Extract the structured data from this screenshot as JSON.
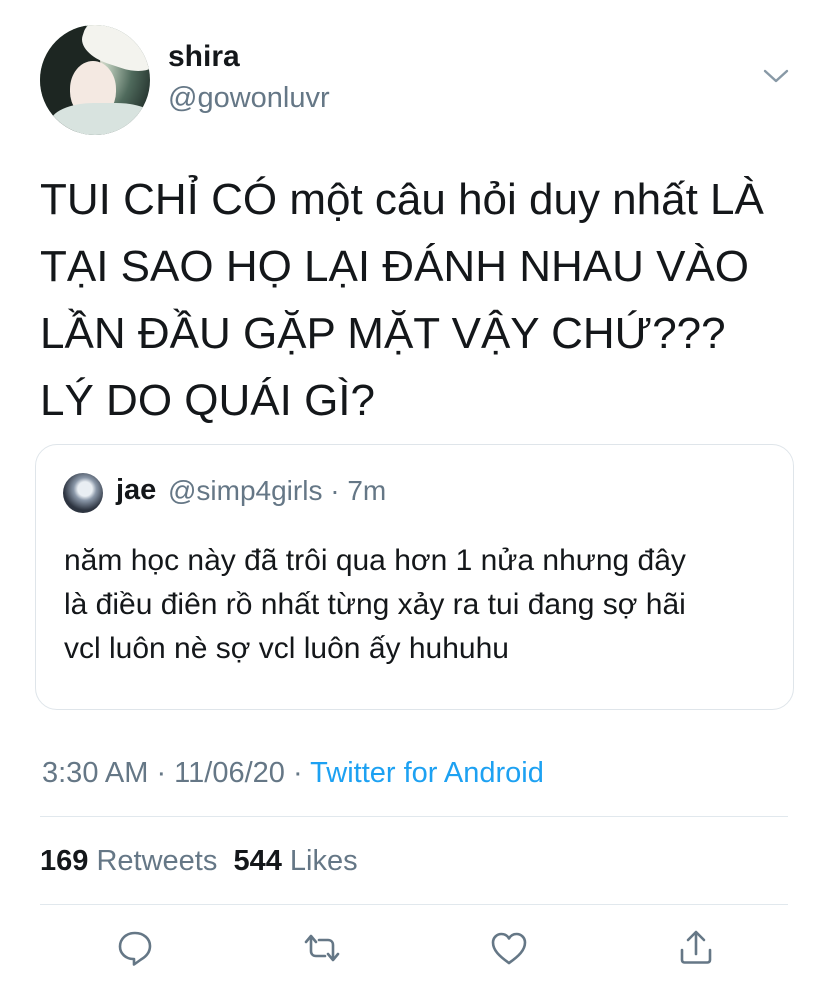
{
  "tweet": {
    "author": {
      "display_name": "shira",
      "handle": "@gowonluvr"
    },
    "text": "TUI CHỈ CÓ một câu hỏi duy nhất LÀ\nTẠI SAO HỌ LẠI ĐÁNH NHAU VÀO\nLẦN ĐẦU GẶP MẶT VẬY CHỨ???\nLÝ DO QUÁI GÌ?",
    "time": "3:30 AM · 11/06/20 · ",
    "source": "Twitter for Android"
  },
  "quoted": {
    "display_name": "jae",
    "meta": "@simp4girls · 7m",
    "text": "năm học này đã trôi qua hơn 1 nửa nhưng đây\nlà điều điên rồ nhất từng xảy ra tui đang sợ hãi\nvcl luôn nè sợ vcl luôn ấy huhuhu"
  },
  "stats": {
    "retweets_count": "169",
    "retweets_label": "Retweets",
    "likes_count": "544",
    "likes_label": "Likes"
  },
  "icons": {
    "menu": "chevron-down-icon",
    "reply": "reply-icon",
    "retweet": "retweet-icon",
    "like": "heart-icon",
    "share": "share-icon"
  },
  "colors": {
    "accent": "#1da1f2",
    "secondary_text": "#657786",
    "primary_text": "#14171a",
    "border": "#e1e8ed"
  }
}
